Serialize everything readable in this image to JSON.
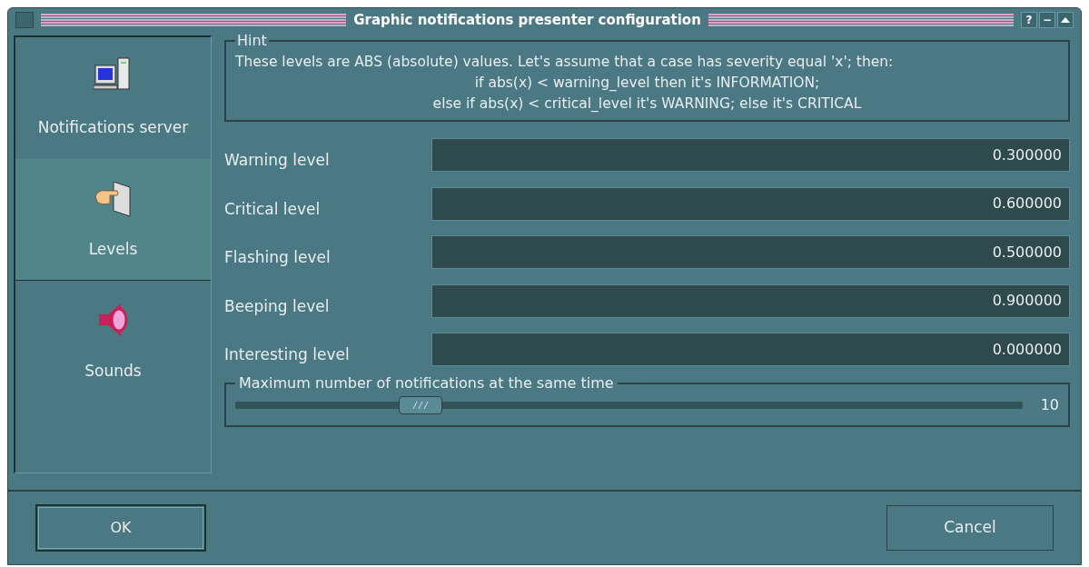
{
  "window": {
    "title": "Graphic notifications presenter configuration",
    "title_buttons": [
      "?",
      "−"
    ]
  },
  "sidebar": {
    "items": [
      {
        "label": "Notifications server",
        "kind": "computer",
        "selected": false
      },
      {
        "label": "Levels",
        "kind": "pointer",
        "selected": true
      },
      {
        "label": "Sounds",
        "kind": "speaker",
        "selected": false
      }
    ]
  },
  "hint": {
    "title": "Hint",
    "lines": [
      "These levels are ABS (absolute) values. Let's assume that a case has severity equal 'x'; then:",
      "if abs(x) < warning_level then it's INFORMATION;",
      "else if abs(x) < critical_level it's WARNING; else it's CRITICAL"
    ]
  },
  "fields": [
    {
      "label": "Warning level",
      "value": "0.300000"
    },
    {
      "label": "Critical level",
      "value": "0.600000"
    },
    {
      "label": "Flashing level",
      "value": "0.500000"
    },
    {
      "label": "Beeping level",
      "value": "0.900000"
    },
    {
      "label": "Interesting level",
      "value": "0.000000"
    }
  ],
  "max_notifications": {
    "title": "Maximum number of notifications at the same time",
    "level": 0.22,
    "reading": "10"
  },
  "buttons": {
    "ok": "OK",
    "cancel": "Cancel"
  }
}
